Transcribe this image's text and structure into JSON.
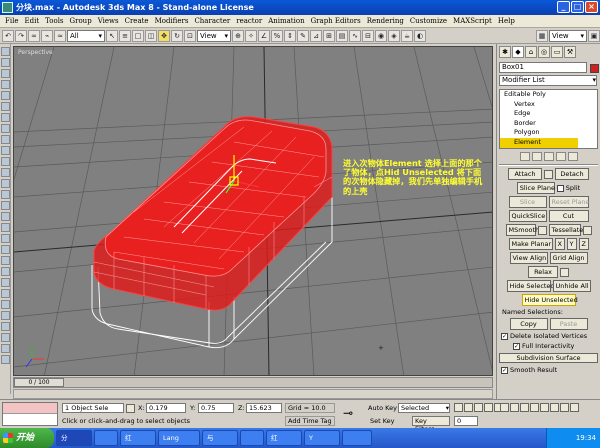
{
  "window": {
    "title": "分块.max - Autodesk 3ds Max 8 - Stand-alone License",
    "controls": [
      "_",
      "□",
      "×"
    ]
  },
  "menu": [
    "File",
    "Edit",
    "Tools",
    "Group",
    "Views",
    "Create",
    "Modifiers",
    "Character",
    "reactor",
    "Animation",
    "Graph Editors",
    "Rendering",
    "Customize",
    "MAXScript",
    "Help"
  ],
  "toolbar": {
    "selection_filter": "All",
    "coord_system": "View",
    "coord_system_right": "View",
    "icons": [
      "undo-icon",
      "redo-icon",
      "link-icon",
      "unlink-icon",
      "bind-icon",
      "select-icon",
      "select-by-name-icon",
      "rect-region-icon",
      "window-crossing-icon",
      "move-icon",
      "rotate-icon",
      "scale-icon",
      "pivot-icon",
      "snap-icon",
      "angle-snap-icon",
      "percent-snap-icon",
      "spinner-snap-icon",
      "mirror-icon",
      "align-icon",
      "layer-icon",
      "curve-editor-icon",
      "schematic-icon",
      "material-editor-icon",
      "render-icon",
      "quick-render-icon"
    ]
  },
  "viewport": {
    "label": "Perspective",
    "annotation": "进入次物体Element 选择上面的那个了物体，点Hid Unselected 将下面的次物体隐藏掉，我们先单独编辑手机的上壳",
    "accent_red": "#e01818"
  },
  "timeline": {
    "frame": "0 / 100"
  },
  "panel": {
    "object_name": "Box01",
    "object_color": "#d02020",
    "modifier_list": "Modifier List",
    "stack": {
      "base": "Editable Poly",
      "levels": [
        "Vertex",
        "Edge",
        "Border",
        "Polygon",
        "Element"
      ],
      "selected": "Element"
    },
    "buttons": {
      "attach": "Attach",
      "detach": "Detach",
      "slice_plane": "Slice Plane",
      "split": "Split",
      "slice": "Slice",
      "reset_plane": "Reset Plane",
      "quickslice": "QuickSlice",
      "cut": "Cut",
      "msmooth": "MSmooth",
      "tessellate": "Tessellate",
      "make_planar": "Make Planar",
      "x": "X",
      "y": "Y",
      "z": "Z",
      "view_align": "View Align",
      "grid_align": "Grid Align",
      "relax": "Relax",
      "hide_selected": "Hide Selected",
      "unhide_all": "Unhide All",
      "hide_unselected": "Hide Unselected",
      "copy": "Copy",
      "paste": "Paste"
    },
    "named_selections": "Named Selections:",
    "delete_isolated": "Delete Isolated Vertices",
    "full_interactivity": "Full Interactivity",
    "subdivision_surface": "Subdivision Surface",
    "smooth_result": "Smooth Result"
  },
  "status": {
    "selected": "1 Object Sele",
    "x_label": "X:",
    "x": "0.179",
    "y_label": "Y:",
    "y": "0.75",
    "z_label": "Z:",
    "z": "15.623",
    "grid": "Grid = 10.0",
    "prompt": "Click or click-and-drag to select objects",
    "add_time_tag": "Add Time Tag",
    "auto_key": "Auto Key",
    "set_key": "Set Key",
    "key_mode": "Selected",
    "key_filters": "Key Filters...",
    "frame_field": "0"
  },
  "taskbar": {
    "start": "开始",
    "items": [
      "分",
      "",
      "红",
      "Lang",
      "与",
      "",
      "红",
      "Y",
      ""
    ],
    "clock": "19:34"
  }
}
